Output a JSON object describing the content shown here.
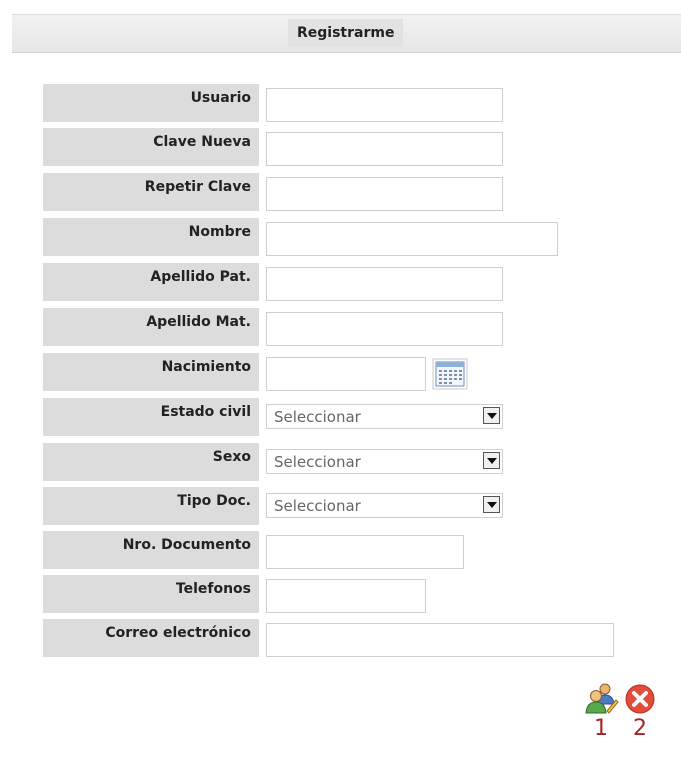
{
  "header": {
    "title": "Registrarme"
  },
  "form": {
    "usuario_label": "Usuario",
    "clave_nueva_label": "Clave Nueva",
    "repetir_clave_label": "Repetir Clave",
    "nombre_label": "Nombre",
    "apellido_pat_label": "Apellido Pat.",
    "apellido_mat_label": "Apellido Mat.",
    "nacimiento_label": "Nacimiento",
    "estado_civil_label": "Estado civil",
    "estado_civil_value": "Seleccionar",
    "sexo_label": "Sexo",
    "sexo_value": "Seleccionar",
    "tipo_doc_label": "Tipo Doc.",
    "tipo_doc_value": "Seleccionar",
    "nro_documento_label": "Nro. Documento",
    "telefonos_label": "Telefonos",
    "correo_label": "Correo electrónico"
  },
  "actions": {
    "register_number": "1",
    "cancel_number": "2"
  },
  "icons": {
    "calendar": "calendar-icon",
    "register": "users-icon",
    "cancel": "close-icon"
  },
  "colors": {
    "label_background": "#dcdcdc",
    "annotation_red": "#a3242a",
    "cancel_red": "#e34b3a"
  }
}
